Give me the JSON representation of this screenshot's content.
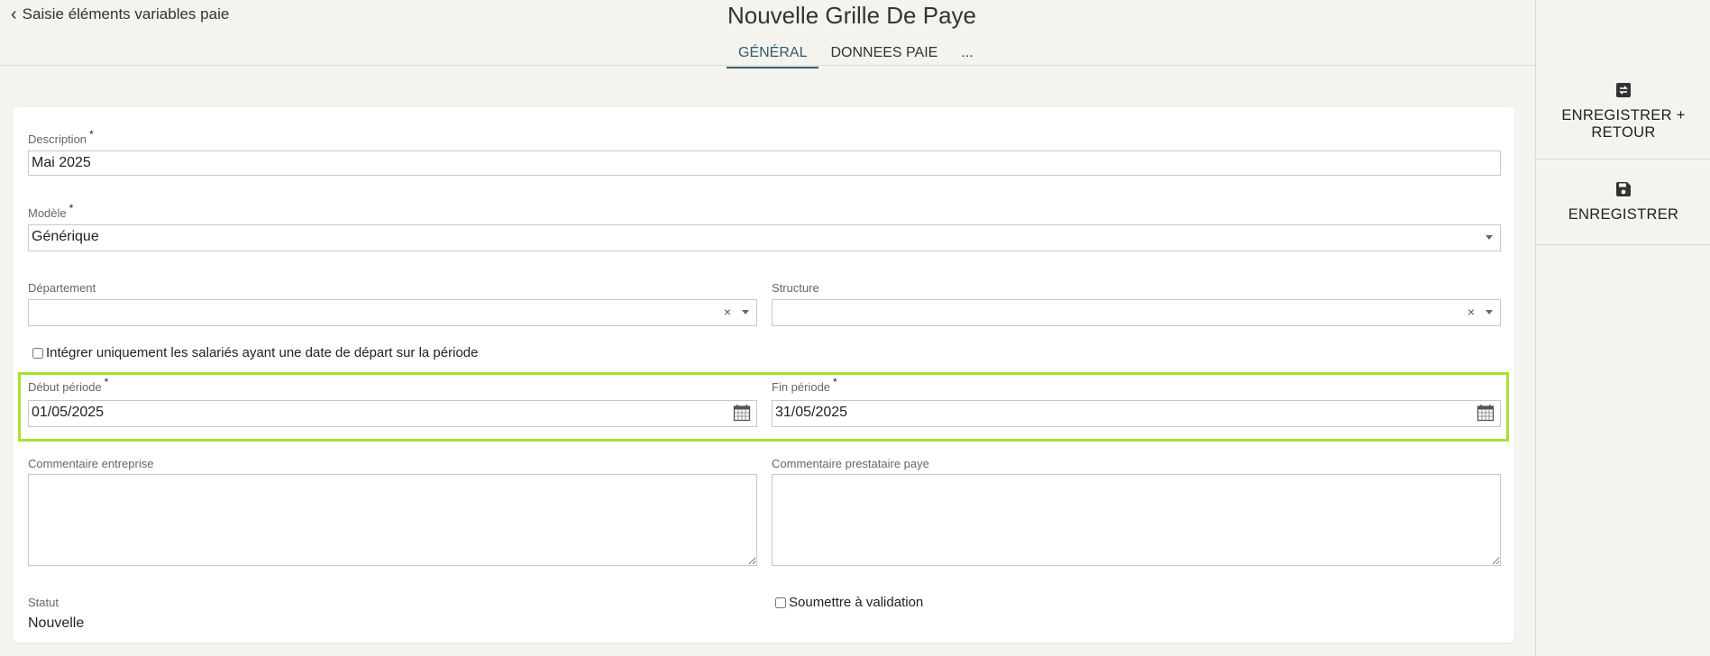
{
  "header": {
    "back_label": "Saisie éléments variables paie",
    "title": "Nouvelle Grille De Paye",
    "tabs": [
      {
        "label": "GÉNÉRAL"
      },
      {
        "label": "DONNEES PAIE"
      },
      {
        "label": "..."
      }
    ]
  },
  "sidebar": {
    "save_return_label": "ENREGISTRER + RETOUR",
    "save_label": "ENREGISTRER"
  },
  "form": {
    "description": {
      "label": "Description",
      "required": "*",
      "value": "Mai 2025"
    },
    "modele": {
      "label": "Modèle",
      "required": "*",
      "value": "Générique"
    },
    "departement": {
      "label": "Département",
      "value": "",
      "clear": "×"
    },
    "structure": {
      "label": "Structure",
      "value": "",
      "clear": "×"
    },
    "integrer_label": "Intégrer uniquement les salariés ayant une date de départ sur la période",
    "debut": {
      "label": "Début période",
      "required": "*",
      "value": "01/05/2025"
    },
    "fin": {
      "label": "Fin période",
      "required": "*",
      "value": "31/05/2025"
    },
    "commentaire_entreprise": {
      "label": "Commentaire entreprise"
    },
    "commentaire_prestataire": {
      "label": "Commentaire prestataire paye"
    },
    "statut": {
      "label": "Statut",
      "value": "Nouvelle"
    },
    "soumettre_label": "Soumettre à validation"
  },
  "colors": {
    "highlight": "#a6e22e",
    "tab_active": "#2e5d6e"
  }
}
